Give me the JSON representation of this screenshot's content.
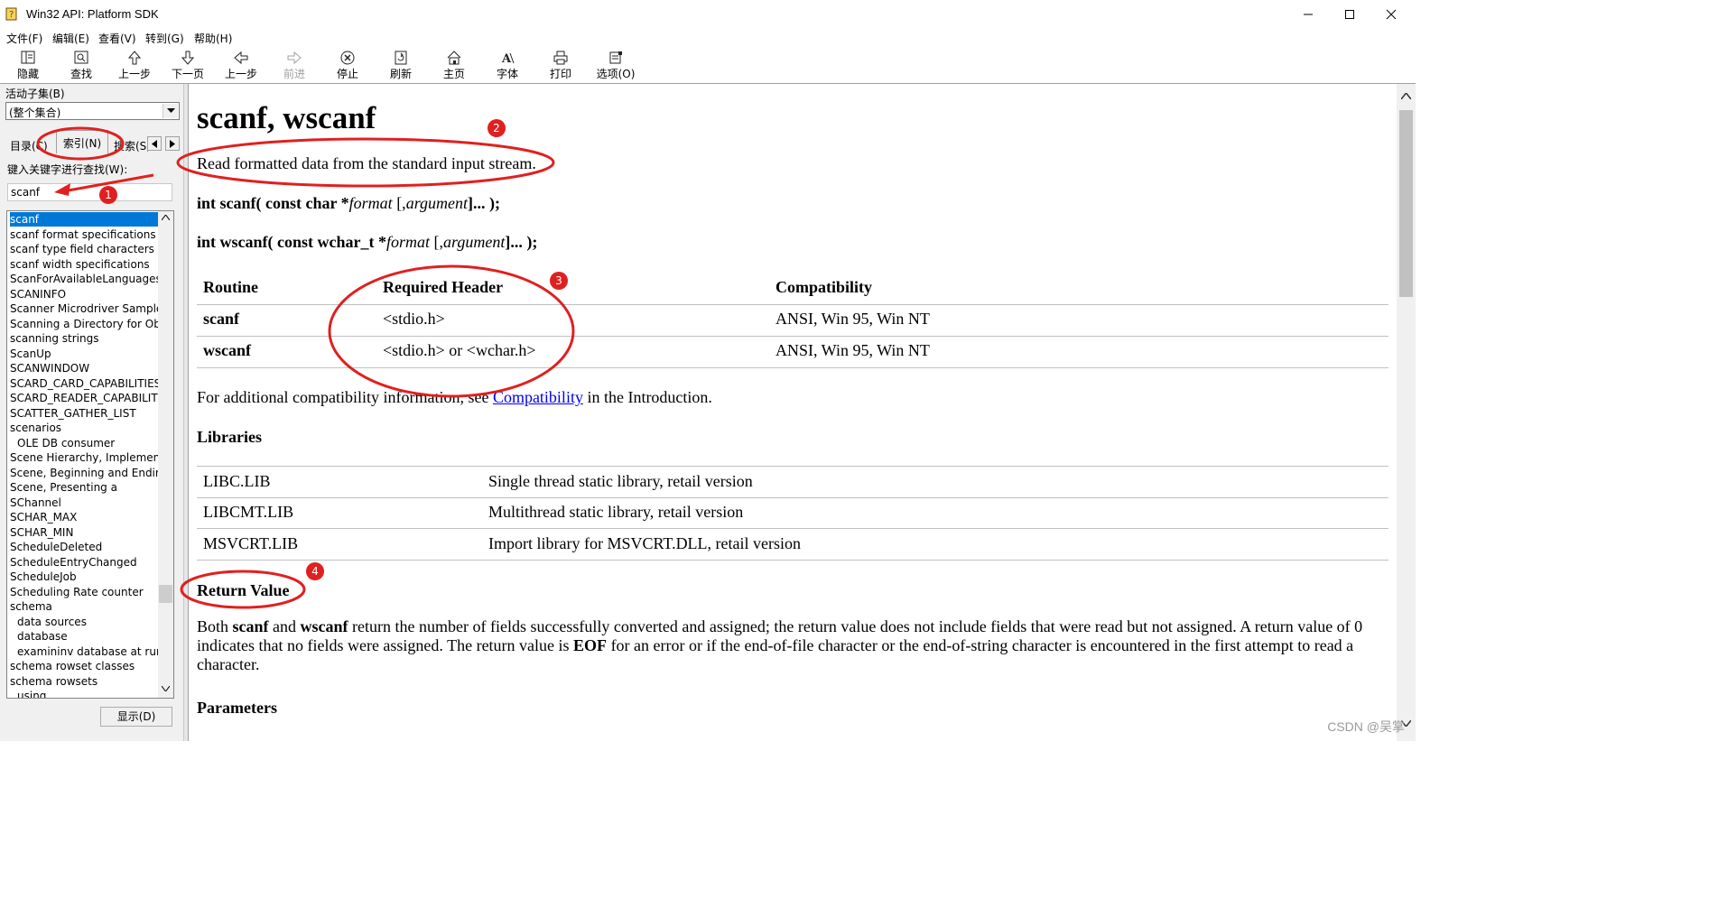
{
  "window": {
    "title": "Win32 API: Platform SDK",
    "controls": [
      "minimize",
      "maximize",
      "close"
    ]
  },
  "menu": [
    "文件(F)",
    "编辑(E)",
    "查看(V)",
    "转到(G)",
    "帮助(H)"
  ],
  "toolbar": [
    {
      "label": "隐藏",
      "icon": "hide-icon",
      "enabled": true
    },
    {
      "label": "查找",
      "icon": "find-icon",
      "enabled": true
    },
    {
      "label": "上一步",
      "icon": "up-arrow-icon",
      "enabled": true
    },
    {
      "label": "下一页",
      "icon": "down-arrow-icon",
      "enabled": true
    },
    {
      "label": "上一步",
      "icon": "back-arrow-icon",
      "enabled": true
    },
    {
      "label": "前进",
      "icon": "forward-arrow-icon",
      "enabled": false
    },
    {
      "label": "停止",
      "icon": "stop-icon",
      "enabled": true
    },
    {
      "label": "刷新",
      "icon": "refresh-icon",
      "enabled": true
    },
    {
      "label": "主页",
      "icon": "home-icon",
      "enabled": true
    },
    {
      "label": "字体",
      "icon": "font-icon",
      "enabled": true
    },
    {
      "label": "打印",
      "icon": "print-icon",
      "enabled": true
    },
    {
      "label": "选项(O)",
      "icon": "options-icon",
      "enabled": true
    }
  ],
  "sidebar": {
    "subset_label": "活动子集(B)",
    "subset_value": "(整个集合)",
    "tabs": [
      "目录(C)",
      "索引(N)",
      "搜索(S)"
    ],
    "active_tab": "索引(N)",
    "keyword_label": "键入关键字进行查找(W):",
    "keyword_value": "scanf",
    "index_items": [
      {
        "text": "scanf",
        "selected": true,
        "indent": false
      },
      {
        "text": "scanf format specifications",
        "indent": false
      },
      {
        "text": "scanf type field characters",
        "indent": false
      },
      {
        "text": "scanf width specifications",
        "indent": false
      },
      {
        "text": "ScanForAvailableLanguages",
        "indent": false
      },
      {
        "text": "SCANINFO",
        "indent": false
      },
      {
        "text": "Scanner Microdriver Sample",
        "indent": false
      },
      {
        "text": "Scanning a Directory for Ob",
        "indent": false
      },
      {
        "text": "scanning strings",
        "indent": false
      },
      {
        "text": "ScanUp",
        "indent": false
      },
      {
        "text": "SCANWINDOW",
        "indent": false
      },
      {
        "text": "SCARD_CARD_CAPABILITIES",
        "indent": false
      },
      {
        "text": "SCARD_READER_CAPABILITIES",
        "indent": false
      },
      {
        "text": "SCATTER_GATHER_LIST",
        "indent": false
      },
      {
        "text": "scenarios",
        "indent": false
      },
      {
        "text": "OLE DB consumer",
        "indent": true
      },
      {
        "text": "Scene Hierarchy, Implemen",
        "indent": false
      },
      {
        "text": "Scene, Beginning and Endin",
        "indent": false
      },
      {
        "text": "Scene, Presenting a",
        "indent": false
      },
      {
        "text": "SChannel",
        "indent": false
      },
      {
        "text": "SCHAR_MAX",
        "indent": false
      },
      {
        "text": "SCHAR_MIN",
        "indent": false
      },
      {
        "text": "ScheduleDeleted",
        "indent": false
      },
      {
        "text": "ScheduleEntryChanged",
        "indent": false
      },
      {
        "text": "ScheduleJob",
        "indent": false
      },
      {
        "text": "Scheduling Rate counter",
        "indent": false
      },
      {
        "text": "schema",
        "indent": false
      },
      {
        "text": "data sources",
        "indent": true
      },
      {
        "text": "database",
        "indent": true
      },
      {
        "text": "examininv database at run",
        "indent": true
      },
      {
        "text": "schema rowset classes",
        "indent": false
      },
      {
        "text": "schema rowsets",
        "indent": false
      },
      {
        "text": "using",
        "indent": true
      }
    ],
    "display_button": "显示(D)"
  },
  "content": {
    "title": "scanf, wscanf",
    "summary": "Read formatted data from the standard input stream.",
    "syntax": [
      {
        "prefix": "int scanf( const char *",
        "param": "format",
        "open": " [,",
        "arg": "argument",
        "close": "]... );"
      },
      {
        "prefix": "int wscanf( const wchar_t *",
        "param": "format",
        "open": " [,",
        "arg": "argument",
        "close": "]... );"
      }
    ],
    "requirements_table": {
      "headers": [
        "Routine",
        "Required Header",
        "Compatibility"
      ],
      "rows": [
        [
          "scanf",
          "<stdio.h>",
          "ANSI, Win 95, Win NT"
        ],
        [
          "wscanf",
          "<stdio.h> or <wchar.h>",
          "ANSI, Win 95, Win NT"
        ]
      ]
    },
    "compat_note_before": "For additional compatibility information, see ",
    "compat_link": "Compatibility",
    "compat_note_after": " in the Introduction.",
    "libraries_heading": "Libraries",
    "libraries": [
      [
        "LIBC.LIB",
        "Single thread static library, retail version"
      ],
      [
        "LIBCMT.LIB",
        "Multithread static library, retail version"
      ],
      [
        "MSVCRT.LIB",
        "Import library for MSVCRT.DLL, retail version"
      ]
    ],
    "return_heading": "Return Value",
    "return_text": {
      "p1": "Both ",
      "b1": "scanf",
      "p2": " and ",
      "b2": "wscanf",
      "p3": " return the number of fields successfully converted and assigned; the return value does not include fields that were read but not assigned. A return value of 0 indicates that no fields were assigned. The return value is ",
      "b3": "EOF",
      "p4": " for an error or if the end-of-file character or the end-of-string character is encountered in the first attempt to read a character."
    },
    "params_heading": "Parameters"
  },
  "annotations": {
    "numbers": [
      "1",
      "2",
      "3",
      "4"
    ],
    "color": "#e02020"
  },
  "watermark": "CSDN @吴掌",
  "colors": {
    "selection": "#0078d7",
    "link": "#0000ee",
    "annotation": "#e02020"
  }
}
